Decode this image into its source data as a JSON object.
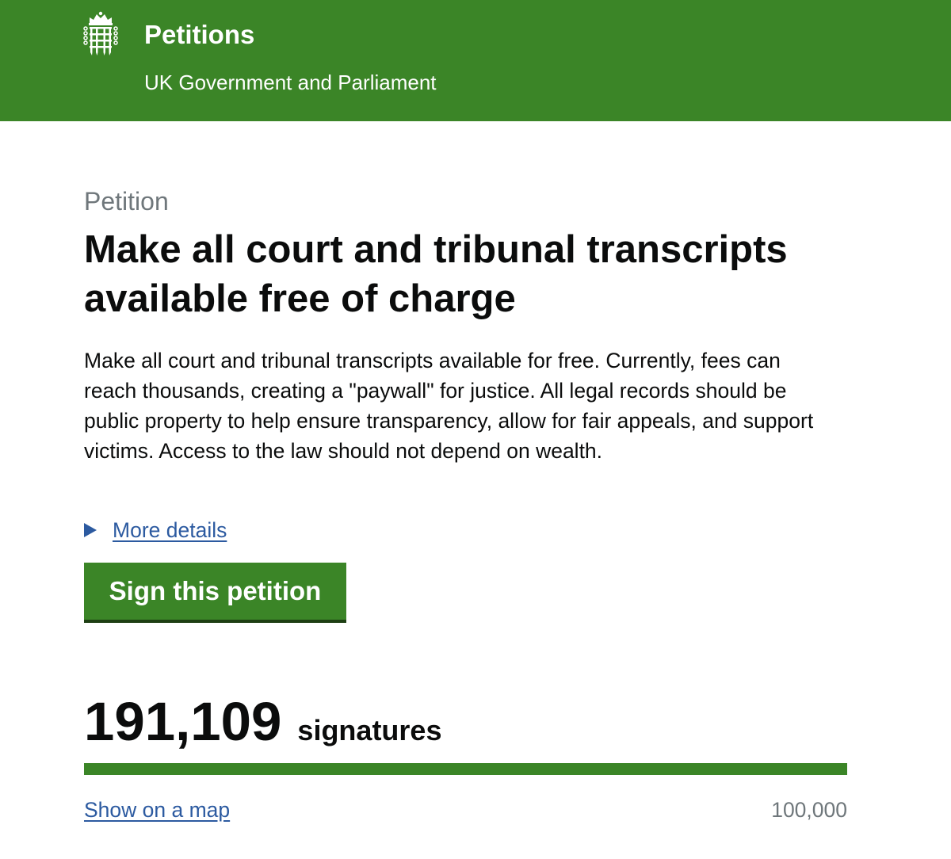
{
  "header": {
    "logo_icon": "portcullis-icon",
    "title": "Petitions",
    "subtitle": "UK Government and Parliament"
  },
  "petition": {
    "caption": "Petition",
    "title": "Make all court and tribunal transcripts available free of charge",
    "summary": "Make all court and tribunal transcripts available for free. Currently, fees can reach thousands, creating a \"paywall\" for justice. All legal records should be public property to help ensure transparency, allow for fair appeals, and support victims. Access to the law should not depend on wealth.",
    "more_details_label": "More details",
    "sign_button_label": "Sign this petition"
  },
  "signatures": {
    "count": "191,109",
    "count_label": "signatures",
    "progress_fraction": 1.0,
    "threshold": "100,000",
    "map_link_label": "Show on a map"
  },
  "colors": {
    "brand_green": "#3b8527",
    "link_blue": "#2c5aa0",
    "secondary_text": "#6f777b"
  }
}
